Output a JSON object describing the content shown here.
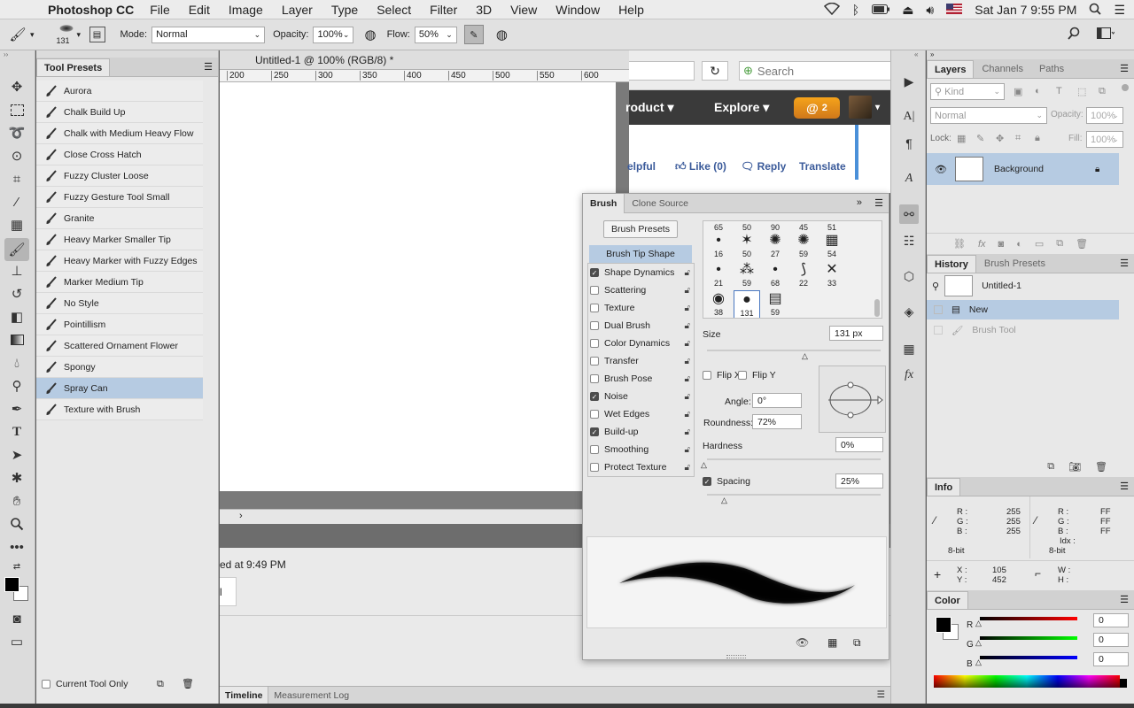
{
  "menubar": {
    "app_name": "Photoshop CC",
    "items": [
      "File",
      "Edit",
      "Image",
      "Layer",
      "Type",
      "Select",
      "Filter",
      "3D",
      "View",
      "Window",
      "Help"
    ],
    "clock": "Sat Jan 7  9:55 PM"
  },
  "options": {
    "brush_size": "131",
    "mode_label": "Mode:",
    "mode_value": "Normal",
    "opacity_label": "Opacity:",
    "opacity_value": "100%",
    "flow_label": "Flow:",
    "flow_value": "50%"
  },
  "tool_presets": {
    "title": "Tool Presets",
    "items": [
      "Aurora",
      "Chalk Build Up",
      "Chalk with Medium Heavy Flow",
      "Close Cross Hatch",
      "Fuzzy Cluster Loose",
      "Fuzzy Gesture Tool Small",
      "Granite",
      "Heavy Marker Smaller Tip",
      "Heavy Marker with Fuzzy Edges",
      "Marker Medium Tip",
      "No Style",
      "Pointillism",
      "Scattered Ornament Flower",
      "Spongy",
      "Spray Can",
      "Texture with Brush"
    ],
    "selected": "Spray Can",
    "footer_label": "Current Tool Only"
  },
  "document": {
    "title": "Untitled-1 @ 100% (RGB/8) *",
    "ruler_ticks": [
      "200",
      "250",
      "300",
      "350",
      "400",
      "450",
      "500",
      "550",
      "600"
    ]
  },
  "browser": {
    "search_placeholder": "Search",
    "nav_product": "roduct",
    "nav_explore": "Explore",
    "notif_count": "2",
    "helpful": "elpful",
    "like": "Like (0)",
    "reply": "Reply",
    "translate": "Translate",
    "posted": "ed at 9:49 PM",
    "stub": "l"
  },
  "brush_panel": {
    "tabs": [
      "Brush",
      "Clone Source"
    ],
    "presets_button": "Brush Presets",
    "tip_shape": "Brush Tip Shape",
    "options": [
      {
        "label": "Shape Dynamics",
        "checked": true
      },
      {
        "label": "Scattering",
        "checked": false
      },
      {
        "label": "Texture",
        "checked": false
      },
      {
        "label": "Dual Brush",
        "checked": false
      },
      {
        "label": "Color Dynamics",
        "checked": false
      },
      {
        "label": "Transfer",
        "checked": false
      },
      {
        "label": "Brush Pose",
        "checked": false
      },
      {
        "label": "Noise",
        "checked": true
      },
      {
        "label": "Wet Edges",
        "checked": false
      },
      {
        "label": "Build-up",
        "checked": true
      },
      {
        "label": "Smoothing",
        "checked": false
      },
      {
        "label": "Protect Texture",
        "checked": false
      }
    ],
    "tip_rows": [
      [
        "65",
        "50",
        "90",
        "45",
        "51"
      ],
      [
        "16",
        "50",
        "27",
        "59",
        "54"
      ],
      [
        "21",
        "59",
        "68",
        "22",
        "33"
      ],
      [
        "38",
        "131",
        "59"
      ]
    ],
    "size_label": "Size",
    "size_value": "131 px",
    "flip_x": "Flip X",
    "flip_y": "Flip Y",
    "angle_label": "Angle:",
    "angle_value": "0°",
    "roundness_label": "Roundness:",
    "roundness_value": "72%",
    "hardness_label": "Hardness",
    "hardness_value": "0%",
    "spacing_label": "Spacing",
    "spacing_value": "25%"
  },
  "layers": {
    "tabs": [
      "Layers",
      "Channels",
      "Paths"
    ],
    "kind_placeholder": "Kind",
    "blend_mode": "Normal",
    "opacity_label": "Opacity:",
    "opacity_value": "100%",
    "lock_label": "Lock:",
    "fill_label": "Fill:",
    "fill_value": "100%",
    "layer_name": "Background"
  },
  "history": {
    "tabs": [
      "History",
      "Brush Presets"
    ],
    "snapshot": "Untitled-1",
    "items": [
      "New",
      "Brush Tool"
    ]
  },
  "info": {
    "title": "Info",
    "r1": "255",
    "g1": "255",
    "b1": "255",
    "r2": "FF",
    "g2": "FF",
    "b2": "FF",
    "bit1": "8-bit",
    "bit2": "8-bit",
    "x": "105",
    "y": "452",
    "labels": {
      "r": "R :",
      "g": "G :",
      "b": "B :",
      "idx": "Idx :",
      "x": "X :",
      "y": "Y :",
      "w": "W :",
      "h": "H :"
    }
  },
  "color": {
    "title": "Color",
    "r": "0",
    "g": "0",
    "b": "0"
  },
  "bottom": {
    "tabs": [
      "Timeline",
      "Measurement Log"
    ]
  }
}
